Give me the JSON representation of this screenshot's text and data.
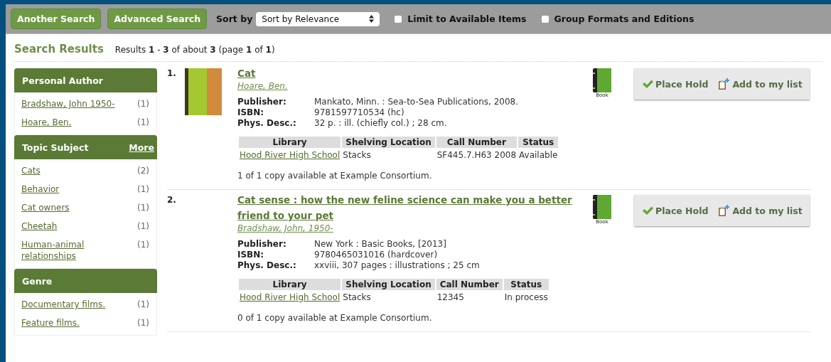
{
  "toolbar": {
    "buttons": [
      "Another Search",
      "Advanced Search"
    ],
    "sort_label": "Sort by",
    "sort_value": "Sort by Relevance",
    "checkboxes": [
      {
        "label": "Limit to Available Items",
        "checked": false
      },
      {
        "label": "Group Formats and Editions",
        "checked": false
      }
    ]
  },
  "header": {
    "title": "Search Results",
    "summary": "Results **1** - **3** of about **3**  (page **1** of **1**)"
  },
  "facets": [
    {
      "title": "Personal Author",
      "items": [
        {
          "label": "Bradshaw, John 1950-",
          "count": "(1)"
        },
        {
          "label": "Hoare, Ben.",
          "count": "(1)"
        }
      ]
    },
    {
      "title": "Topic Subject",
      "more": "More",
      "items": [
        {
          "label": "Cats",
          "count": "(2)"
        },
        {
          "label": "Behavior",
          "count": "(1)"
        },
        {
          "label": "Cat owners",
          "count": "(1)"
        },
        {
          "label": "Cheetah",
          "count": "(1)"
        },
        {
          "label": "Human-animal relationships",
          "count": "(1)"
        }
      ]
    },
    {
      "title": "Genre",
      "items": [
        {
          "label": "Documentary films.",
          "count": "(1)"
        },
        {
          "label": "Feature films.",
          "count": "(1)"
        }
      ]
    }
  ],
  "results": [
    {
      "number": "1.",
      "cover": true,
      "title": "Cat",
      "author": "Hoare, Ben.",
      "fields": [
        {
          "label": "Publisher:",
          "value": "Mankato, Minn. : Sea-to-Sea Publications, 2008."
        },
        {
          "label": "ISBN:",
          "value": "9781597710534 (hc)"
        },
        {
          "label": "Phys. Desc.:",
          "value": "32 p. : ill. (chiefly col.) ; 28 cm."
        }
      ],
      "holdings": {
        "columns": [
          "Library",
          "Shelving Location",
          "Call Number",
          "Status"
        ],
        "rows": [
          [
            "Hood River High School",
            "Stacks",
            "SF445.7.H63 2008",
            "Available"
          ]
        ]
      },
      "availability": "1 of 1 copy available at Example Consortium.",
      "format": "Book",
      "actions": [
        "Place Hold",
        "Add to my list"
      ]
    },
    {
      "number": "2.",
      "cover": false,
      "title": "Cat sense : how the new feline science can make you a better friend to your pet",
      "author": "Bradshaw, John, 1950-",
      "fields": [
        {
          "label": "Publisher:",
          "value": "New York : Basic Books, [2013]"
        },
        {
          "label": "ISBN:",
          "value": "9780465031016 (hardcover)"
        },
        {
          "label": "Phys. Desc.:",
          "value": "xxviii, 307 pages : illustrations ; 25 cm"
        }
      ],
      "holdings": {
        "columns": [
          "Library",
          "Shelving Location",
          "Call Number",
          "Status"
        ],
        "rows": [
          [
            "Hood River High School",
            "Stacks",
            "12345",
            "In process"
          ]
        ]
      },
      "availability": "0 of 1 copy available at Example Consortium.",
      "format": "Book",
      "actions": [
        "Place Hold",
        "Add to my list"
      ]
    }
  ]
}
